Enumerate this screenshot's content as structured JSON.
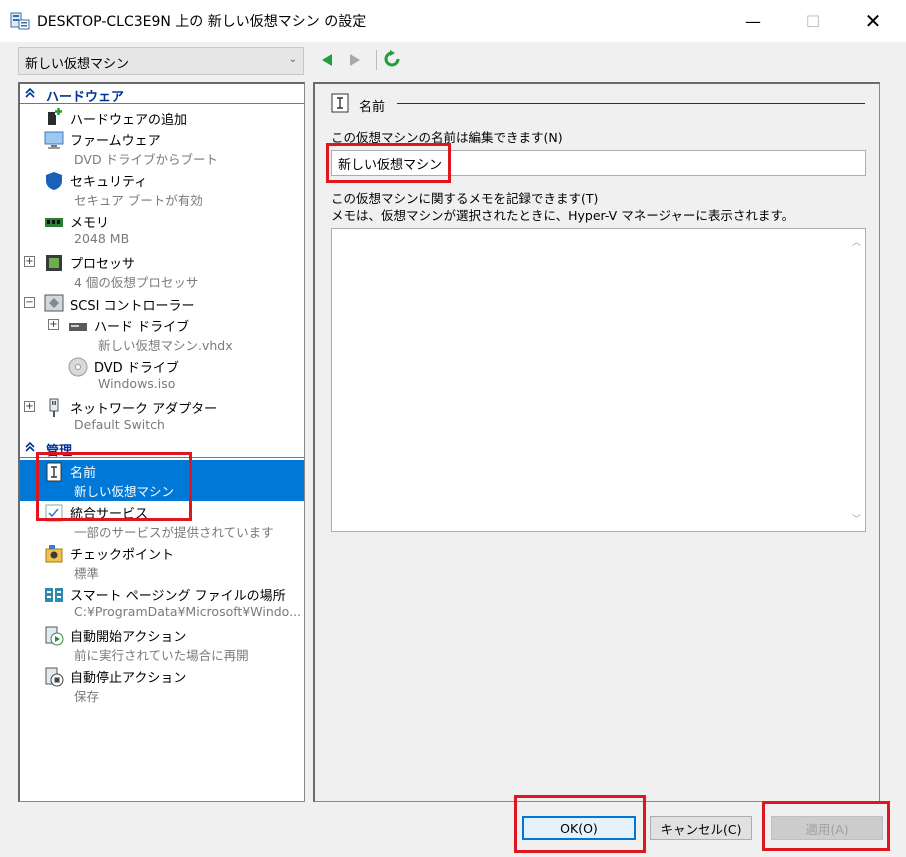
{
  "window": {
    "title": "DESKTOP-CLC3E9N 上の 新しい仮想マシン の設定",
    "minimize": "—",
    "maximize": "☐",
    "close": "✕"
  },
  "vm_selector": {
    "value": "新しい仮想マシン",
    "caret": "⌄"
  },
  "hardware_section": {
    "label": "ハードウェア"
  },
  "management_section": {
    "label": "管理"
  },
  "hardware_items": [
    {
      "title": "ハードウェアの追加"
    },
    {
      "title": "ファームウェア",
      "subtitle": "DVD ドライブからブート"
    },
    {
      "title": "セキュリティ",
      "subtitle": "セキュア ブートが有効"
    },
    {
      "title": "メモリ",
      "subtitle": "2048 MB"
    },
    {
      "title": "プロセッサ",
      "subtitle": "4 個の仮想プロセッサ"
    },
    {
      "title": "SCSI コントローラー"
    },
    {
      "title": "ハード ドライブ",
      "subtitle": "新しい仮想マシン.vhdx"
    },
    {
      "title": "DVD ドライブ",
      "subtitle": "Windows.iso"
    },
    {
      "title": "ネットワーク アダプター",
      "subtitle": "Default Switch"
    }
  ],
  "management_items": [
    {
      "title": "名前",
      "subtitle": "新しい仮想マシン"
    },
    {
      "title": "統合サービス",
      "subtitle": "一部のサービスが提供されています"
    },
    {
      "title": "チェックポイント",
      "subtitle": "標準"
    },
    {
      "title": "スマート ページング ファイルの場所",
      "subtitle": "C:¥ProgramData¥Microsoft¥Windo..."
    },
    {
      "title": "自動開始アクション",
      "subtitle": "前に実行されていた場合に再開"
    },
    {
      "title": "自動停止アクション",
      "subtitle": "保存"
    }
  ],
  "expanders": {
    "plus": "+",
    "minus": "−"
  },
  "detail": {
    "group_title": "名前",
    "name_label": "この仮想マシンの名前は編集できます(N)",
    "name_value": "新しい仮想マシン",
    "notes_label_1": "この仮想マシンに関するメモを記録できます(T)",
    "notes_label_2": "メモは、仮想マシンが選択されたときに、Hyper-V マネージャーに表示されます。",
    "notes_value": ""
  },
  "buttons": {
    "ok": "OK(O)",
    "cancel": "キャンセル(C)",
    "apply": "適用(A)"
  },
  "colors": {
    "selection": "#0078d7",
    "section_header": "#003399",
    "highlight": "#e0161e"
  }
}
